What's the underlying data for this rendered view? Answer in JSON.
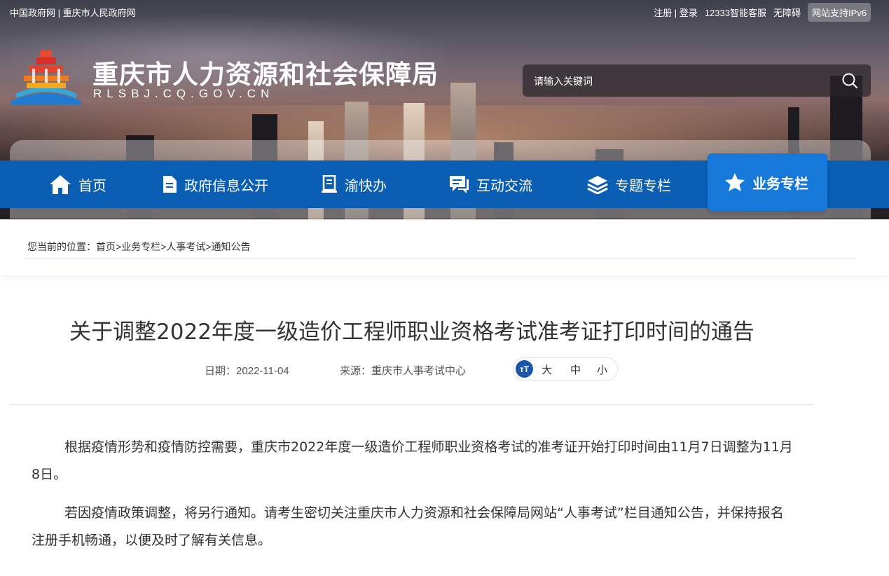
{
  "topbar": {
    "left_links": [
      "中国政府网",
      "重庆市人民政府网"
    ],
    "separator": "|",
    "register": "注册",
    "login": "登录",
    "service": "12333智能客服",
    "accessibility": "无障碍",
    "ipv6": "网站支持IPv6"
  },
  "header": {
    "title": "重庆市人力资源和社会保障局",
    "domain": "RLSBJ.CQ.GOV.CN",
    "search_placeholder": "请输入关键词"
  },
  "nav": {
    "items": [
      {
        "label": "首页",
        "icon": "home-icon"
      },
      {
        "label": "政府信息公开",
        "icon": "document-icon"
      },
      {
        "label": "渝快办",
        "icon": "clipboard-icon"
      },
      {
        "label": "互动交流",
        "icon": "chat-icon"
      },
      {
        "label": "专题专栏",
        "icon": "layers-icon"
      },
      {
        "label": "业务专栏",
        "icon": "star-icon",
        "active": true
      }
    ],
    "color": "#0a5fb4",
    "active_color": "#1678d8"
  },
  "breadcrumb": {
    "prefix": "您当前的位置：",
    "path": [
      "首页",
      "业务专栏",
      "人事考试",
      "通知公告"
    ],
    "separator": ">"
  },
  "article": {
    "title": "关于调整2022年度一级造价工程师职业资格考试准考证打印时间的通告",
    "date_label": "日期：",
    "date": "2022-11-04",
    "source_label": "来源：",
    "source": "重庆市人事考试中心",
    "font_size_icon_text": "тT",
    "font_sizes": [
      "大",
      "中",
      "小"
    ],
    "paragraphs": [
      "根据疫情形势和疫情防控需要，重庆市2022年度一级造价工程师职业资格考试的准考证开始打印时间由11月7日调整为11月8日。",
      "若因疫情政策调整，将另行通知。请考生密切关注重庆市人力资源和社会保障局网站“人事考试”栏目通知公告，并保持报名注册手机畅通，以便及时了解有关信息。"
    ]
  }
}
